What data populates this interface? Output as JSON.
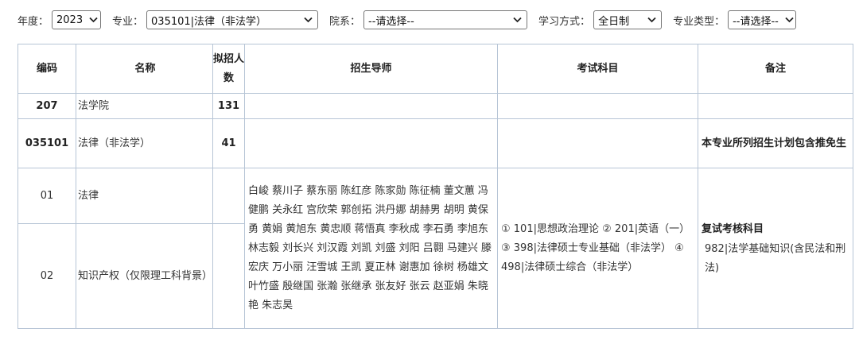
{
  "filters": {
    "year_label": "年度：",
    "year_value": "2023",
    "major_label": "专业：",
    "major_value": "035101|法律（非法学）",
    "dept_label": "院系：",
    "dept_value": "--请选择--",
    "mode_label": "学习方式：",
    "mode_value": "全日制",
    "type_label": "专业类型：",
    "type_value": "--请选择--",
    "dropdown_icon": "chevron-down-icon"
  },
  "table": {
    "headers": {
      "code": "编码",
      "name": "名称",
      "quota": "拟招人数",
      "tutors": "招生导师",
      "exam": "考试科目",
      "remark": "备注"
    },
    "college": {
      "code": "207",
      "name": "法学院",
      "quota": "131"
    },
    "major": {
      "code": "035101",
      "name": "法律（非法学）",
      "quota": "41",
      "remark": "本专业所列招生计划包含推免生"
    },
    "directions": [
      {
        "code": "01",
        "name": "法律"
      },
      {
        "code": "02",
        "name": "知识产权（仅限理工科背景）"
      }
    ],
    "tutors": "白峻 蔡川子 蔡东丽 陈红彦 陈家勋 陈征楠 董文蕙 冯健鹏 关永红 宫欣荣 郭创拓 洪丹娜 胡赫男 胡明 黄保勇 黄娟 黄旭东 黄忠顺 蒋悟真 李秋成 李石勇 李旭东 林志毅 刘长兴 刘汉霞 刘凯 刘盛 刘阳 吕翾 马建兴 滕宏庆 万小丽 汪雪城 王凯 夏正林 谢惠加 徐树 杨雄文 叶竹盛 殷继国 张瀚 张继承 张友好 张云 赵亚娟 朱晓艳 朱志昊",
    "exam": "① 101|思想政治理论 ② 201|英语（一） ③ 398|法律硕士专业基础（非法学） ④ 498|法律硕士综合（非法学）",
    "retest_title": "复试考核科目",
    "retest_body": "982|法学基础知识(含民法和刑法)"
  }
}
